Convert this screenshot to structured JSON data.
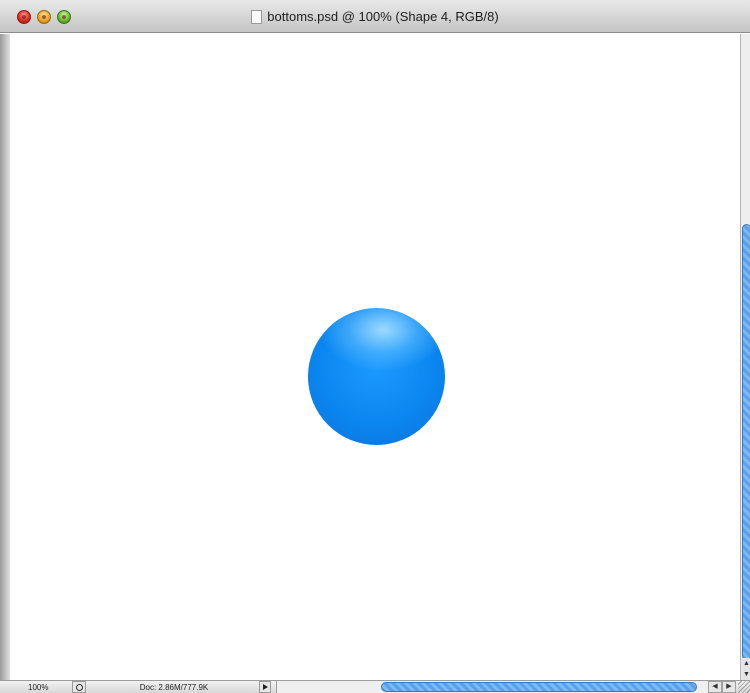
{
  "window": {
    "title": "bottoms.psd @ 100% (Shape 4, RGB/8)"
  },
  "canvas": {
    "shape_color": "#0b86f0",
    "highlight_color": "#a5deff"
  },
  "status": {
    "zoom": "100%",
    "doc_info": "Doc: 2.86M/777.9K"
  },
  "icons": {
    "close": "close-icon",
    "minimize": "minimize-icon",
    "zoom": "zoom-icon",
    "document": "document-icon",
    "navigator": "magnifier-icon",
    "menu_arrow": "triangle-right-icon"
  },
  "accent": "#5aa0ea"
}
